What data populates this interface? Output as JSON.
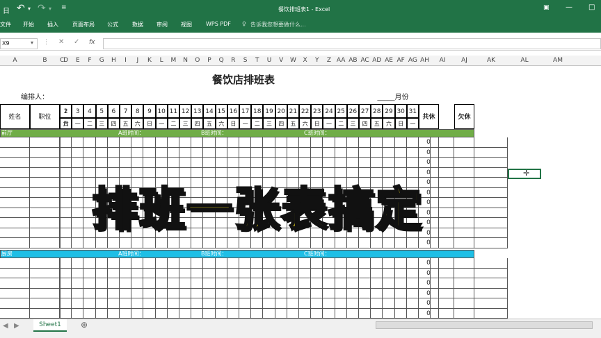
{
  "window": {
    "title": "餐饮排班表1 - Excel",
    "file_icon": "日"
  },
  "ribbon": {
    "tabs": [
      "文件",
      "开始",
      "插入",
      "页面布局",
      "公式",
      "数据",
      "审阅",
      "视图",
      "WPS PDF"
    ],
    "tell_me": "告诉我您想要做什么..."
  },
  "formula_bar": {
    "name_box": "X9",
    "fx_label": "fx"
  },
  "columns": [
    "A",
    "B",
    "C",
    "D",
    "E",
    "F",
    "G",
    "H",
    "I",
    "J",
    "K",
    "L",
    "M",
    "N",
    "O",
    "P",
    "Q",
    "R",
    "S",
    "T",
    "U",
    "V",
    "W",
    "X",
    "Y",
    "Z",
    "AA",
    "AB",
    "AC",
    "AD",
    "AE",
    "AF",
    "AG",
    "AH",
    "AI",
    "AJ",
    "AK",
    "AL",
    "AM"
  ],
  "sheet": {
    "title": "餐饮店排班表",
    "scheduler_label": "编排人：",
    "month_label": "_____月份",
    "header_name": "姓名",
    "header_position": "职位",
    "days": [
      "1",
      "2",
      "3",
      "4",
      "5",
      "6",
      "7",
      "8",
      "9",
      "10",
      "11",
      "12",
      "13",
      "14",
      "15",
      "16",
      "17",
      "18",
      "19",
      "20",
      "21",
      "22",
      "23",
      "24",
      "25",
      "26",
      "27",
      "28",
      "29",
      "30",
      "31"
    ],
    "weekdays": [
      "六",
      "日",
      "一",
      "二",
      "三",
      "四",
      "五",
      "六",
      "日",
      "一",
      "二",
      "三",
      "四",
      "五",
      "六",
      "日",
      "一",
      "二",
      "三",
      "四",
      "五",
      "六",
      "日",
      "一",
      "二",
      "三",
      "四",
      "五",
      "六",
      "日",
      "一"
    ],
    "header_rest": "共休",
    "header_off": "欠休",
    "section1": {
      "name": "前厅",
      "a": "A班时间：",
      "b": "B班时间：",
      "c": "C班时间：",
      "color": "#70ad47"
    },
    "section2": {
      "name": "厨房",
      "a": "A班时间：",
      "b": "B班时间：",
      "c": "C班时间：",
      "color": "#1ebfe6"
    },
    "zero": "0"
  },
  "tabs": {
    "sheet1": "Sheet1",
    "add": "⊕"
  },
  "overlay_text": "排班一张表搞定",
  "colors": {
    "excel_green": "#217346",
    "overlay_fill": "#ffe81a"
  }
}
